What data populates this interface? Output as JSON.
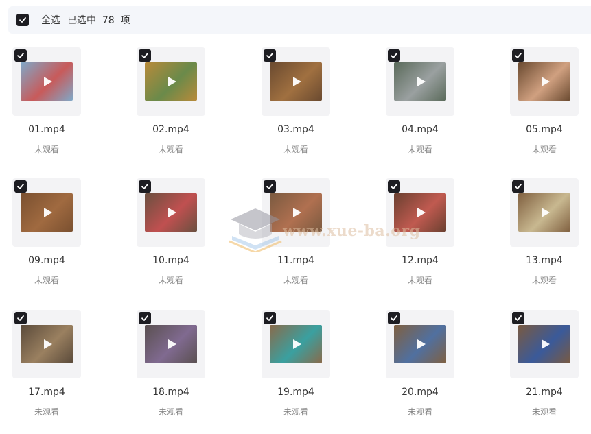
{
  "toolbar": {
    "select_all_label": "全选",
    "selected_count_label": "已选中  78  项"
  },
  "files": [
    {
      "name": "01.mp4",
      "status": "未观看",
      "tint": [
        "#7fa8c8",
        "#c85a5a"
      ]
    },
    {
      "name": "02.mp4",
      "status": "未观看",
      "tint": [
        "#b88a3a",
        "#6a8a4a"
      ]
    },
    {
      "name": "03.mp4",
      "status": "未观看",
      "tint": [
        "#6a4a30",
        "#a07040"
      ]
    },
    {
      "name": "04.mp4",
      "status": "未观看",
      "tint": [
        "#5a6a5a",
        "#9aa0a0"
      ]
    },
    {
      "name": "05.mp4",
      "status": "未观看",
      "tint": [
        "#6a4a30",
        "#d0a080"
      ]
    },
    {
      "name": "09.mp4",
      "status": "未观看",
      "tint": [
        "#7a5030",
        "#a06a40"
      ]
    },
    {
      "name": "10.mp4",
      "status": "未观看",
      "tint": [
        "#6a5040",
        "#c05050"
      ]
    },
    {
      "name": "11.mp4",
      "status": "未观看",
      "tint": [
        "#7a5a40",
        "#b07050"
      ]
    },
    {
      "name": "12.mp4",
      "status": "未观看",
      "tint": [
        "#6a4030",
        "#c05a50"
      ]
    },
    {
      "name": "13.mp4",
      "status": "未观看",
      "tint": [
        "#806040",
        "#c8b890"
      ]
    },
    {
      "name": "17.mp4",
      "status": "未观看",
      "tint": [
        "#5a4a3a",
        "#9a8060"
      ]
    },
    {
      "name": "18.mp4",
      "status": "未观看",
      "tint": [
        "#5a5050",
        "#806a90"
      ]
    },
    {
      "name": "19.mp4",
      "status": "未观看",
      "tint": [
        "#8a6a4a",
        "#3aa0a0"
      ]
    },
    {
      "name": "20.mp4",
      "status": "未观看",
      "tint": [
        "#806040",
        "#5070a0"
      ]
    },
    {
      "name": "21.mp4",
      "status": "未观看",
      "tint": [
        "#7a5a40",
        "#3a5a9a"
      ]
    }
  ],
  "watermark": {
    "text": "www.xue-ba.org"
  }
}
